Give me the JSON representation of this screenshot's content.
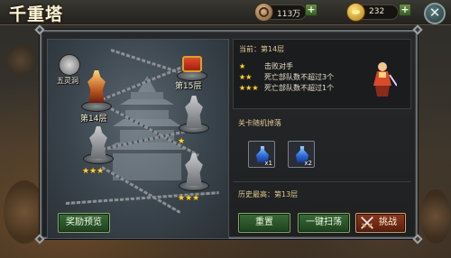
{
  "header": {
    "title": "千重塔",
    "currency_coin": "113万",
    "currency_gold": "232",
    "coin_icon": "coin-icon",
    "gold_icon": "gold-ingot-icon",
    "close_icon": "close-icon"
  },
  "map": {
    "five_element_label": "五灵洞",
    "stages": [
      {
        "label": "第14层",
        "stars": "",
        "state": "current"
      },
      {
        "label": "第15层",
        "stars": "",
        "state": "reward-chest"
      },
      {
        "label": "",
        "stars": "★",
        "state": "cleared"
      },
      {
        "label": "",
        "stars": "★★★",
        "state": "cleared"
      },
      {
        "label": "",
        "stars": "★★★",
        "state": "cleared"
      }
    ],
    "reward_preview_button": "奖励预览"
  },
  "info": {
    "current_floor": "当前：第14层",
    "conditions": [
      {
        "stars": "★",
        "text": "击败对手"
      },
      {
        "stars": "★★",
        "text": "死亡部队数不超过3个"
      },
      {
        "stars": "★★★",
        "text": "死亡部队数不超过1个"
      }
    ],
    "drop_title": "关卡随机掉落",
    "drops": [
      {
        "icon": "blue-potion-icon",
        "qty": "x1"
      },
      {
        "icon": "blue-potion-icon",
        "qty": "x2"
      }
    ],
    "history_best": "历史最高：第13层",
    "reset_button": "重置",
    "sweep_button": "一键扫荡",
    "challenge_button": "挑战"
  },
  "colors": {
    "star": "#ffd23a",
    "green_button": "#3a6a3a",
    "red_button": "#8a3a1e",
    "section_title": "#e0c890"
  }
}
